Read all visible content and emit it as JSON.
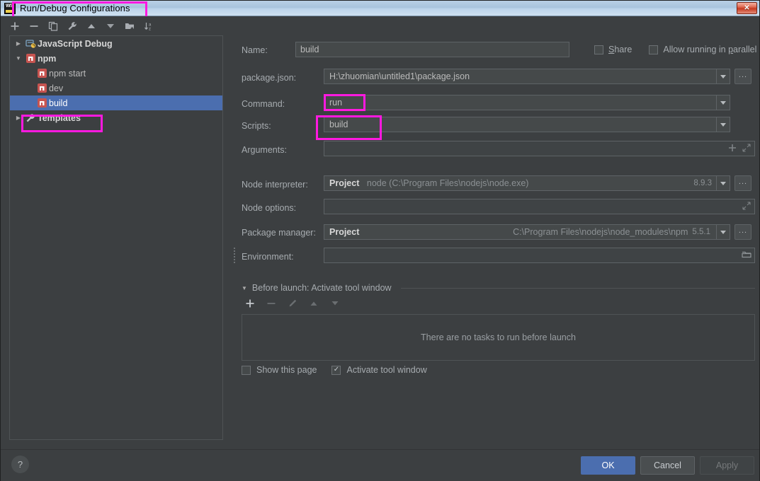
{
  "window": {
    "title": "Run/Debug Configurations",
    "app_icon": "webstorm-icon",
    "close_label": "✕"
  },
  "tree_toolbar": [
    {
      "name": "add-configuration-button",
      "icon": "plus-icon"
    },
    {
      "name": "remove-configuration-button",
      "icon": "minus-icon"
    },
    {
      "name": "copy-configuration-button",
      "icon": "copy-icon"
    },
    {
      "name": "edit-templates-button",
      "icon": "wrench-icon"
    },
    {
      "name": "move-up-button",
      "icon": "arrow-up-icon"
    },
    {
      "name": "move-down-button",
      "icon": "arrow-down-icon"
    },
    {
      "name": "create-folder-button",
      "icon": "folder-add-icon"
    },
    {
      "name": "sort-configurations-button",
      "icon": "sort-az-icon"
    }
  ],
  "tree": [
    {
      "label": "JavaScript Debug",
      "icon": "javascript-debug-icon",
      "level": 0,
      "twisty": "▶",
      "group": true,
      "selected": false
    },
    {
      "label": "npm",
      "icon": "npm-icon",
      "level": 0,
      "twisty": "▼",
      "group": true,
      "selected": false
    },
    {
      "label": "npm start",
      "icon": "npm-icon",
      "level": 1,
      "twisty": "",
      "group": false,
      "selected": false
    },
    {
      "label": "dev",
      "icon": "npm-icon",
      "level": 1,
      "twisty": "",
      "group": false,
      "selected": false
    },
    {
      "label": "build",
      "icon": "npm-icon",
      "level": 1,
      "twisty": "",
      "group": false,
      "selected": true
    },
    {
      "label": "Templates",
      "icon": "wrench-icon",
      "level": 0,
      "twisty": "▶",
      "group": true,
      "selected": false
    }
  ],
  "form": {
    "name_label": "Name:",
    "name_value": "build",
    "share_label": "Share",
    "share_mnemonic": "S",
    "share_checked": false,
    "parallel_label": "Allow running in parallel",
    "parallel_checked": false,
    "package_json_label": "package.json:",
    "package_json_value": "H:\\zhuomian\\untitled1\\package.json",
    "command_label": "Command:",
    "command_value": "run",
    "scripts_label": "Scripts:",
    "scripts_value": "build",
    "arguments_label": "Arguments:",
    "arguments_value": "",
    "node_interpreter_label": "Node interpreter:",
    "node_interpreter_scope": "Project",
    "node_interpreter_value": "node (C:\\Program Files\\nodejs\\node.exe)",
    "node_interpreter_version": "8.9.3",
    "node_options_label": "Node options:",
    "node_options_value": "",
    "package_manager_label": "Package manager:",
    "package_manager_scope": "Project",
    "package_manager_path": "C:\\Program Files\\nodejs\\node_modules\\npm",
    "package_manager_version": "5.5.1",
    "environment_label": "Environment:",
    "environment_value": "",
    "browse_label": "...",
    "add_argument_icon": "plus-icon",
    "expand_icon": "expand-icon",
    "folder_icon": "folder-icon"
  },
  "before_launch": {
    "header": "Before launch: Activate tool window",
    "twisty": "▼",
    "toolbar": [
      {
        "name": "add-task-button",
        "icon": "plus-icon",
        "enabled": true
      },
      {
        "name": "remove-task-button",
        "icon": "minus-icon",
        "enabled": false
      },
      {
        "name": "edit-task-button",
        "icon": "pencil-icon",
        "enabled": false
      },
      {
        "name": "move-task-up-button",
        "icon": "arrow-up-icon",
        "enabled": false
      },
      {
        "name": "move-task-down-button",
        "icon": "arrow-down-icon",
        "enabled": false
      }
    ],
    "empty_text": "There are no tasks to run before launch",
    "show_page_label": "Show this page",
    "show_page_checked": false,
    "activate_window_label": "Activate tool window",
    "activate_window_checked": true,
    "check_glyph": "✓"
  },
  "footer": {
    "help_label": "?",
    "ok_label": "OK",
    "cancel_label": "Cancel",
    "apply_label": "Apply"
  },
  "highlights": {
    "color": "#ff19e0",
    "regions": [
      "title",
      "tree-build-item",
      "command-value",
      "scripts-value"
    ]
  }
}
